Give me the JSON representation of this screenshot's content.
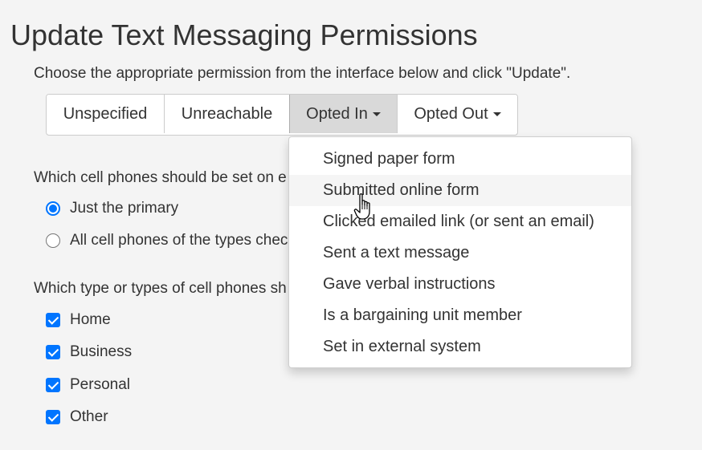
{
  "page": {
    "title": "Update Text Messaging Permissions",
    "instructions": "Choose the appropriate permission from the interface below and click \"Update\"."
  },
  "permission_buttons": [
    {
      "label": "Unspecified"
    },
    {
      "label": "Unreachable"
    },
    {
      "label": "Opted In",
      "active": true
    },
    {
      "label": "Opted Out"
    }
  ],
  "phones_question": {
    "label": "Which cell phones should be set on e",
    "options": [
      {
        "label": "Just the primary",
        "checked": true
      },
      {
        "label": "All cell phones of the types chec",
        "checked": false
      }
    ]
  },
  "types_question": {
    "label": "Which type or types of cell phones sh",
    "options": [
      {
        "label": "Home",
        "checked": true
      },
      {
        "label": "Business",
        "checked": true
      },
      {
        "label": "Personal",
        "checked": true
      },
      {
        "label": "Other",
        "checked": true
      }
    ]
  },
  "opted_in_menu": {
    "items": [
      {
        "label": "Signed paper form"
      },
      {
        "label": "Submitted online form",
        "hovered": true
      },
      {
        "label": "Clicked emailed link (or sent an email)"
      },
      {
        "label": "Sent a text message"
      },
      {
        "label": "Gave verbal instructions"
      },
      {
        "label": "Is a bargaining unit member"
      },
      {
        "label": "Set in external system"
      }
    ]
  },
  "colors": {
    "accent": "#0075ff",
    "background": "#f4f4f4",
    "active_button": "#d9d9d9",
    "hover_item": "#f5f5f5"
  },
  "icons": {
    "cursor": "hand-pointer-icon",
    "caret": "caret-down-icon"
  }
}
